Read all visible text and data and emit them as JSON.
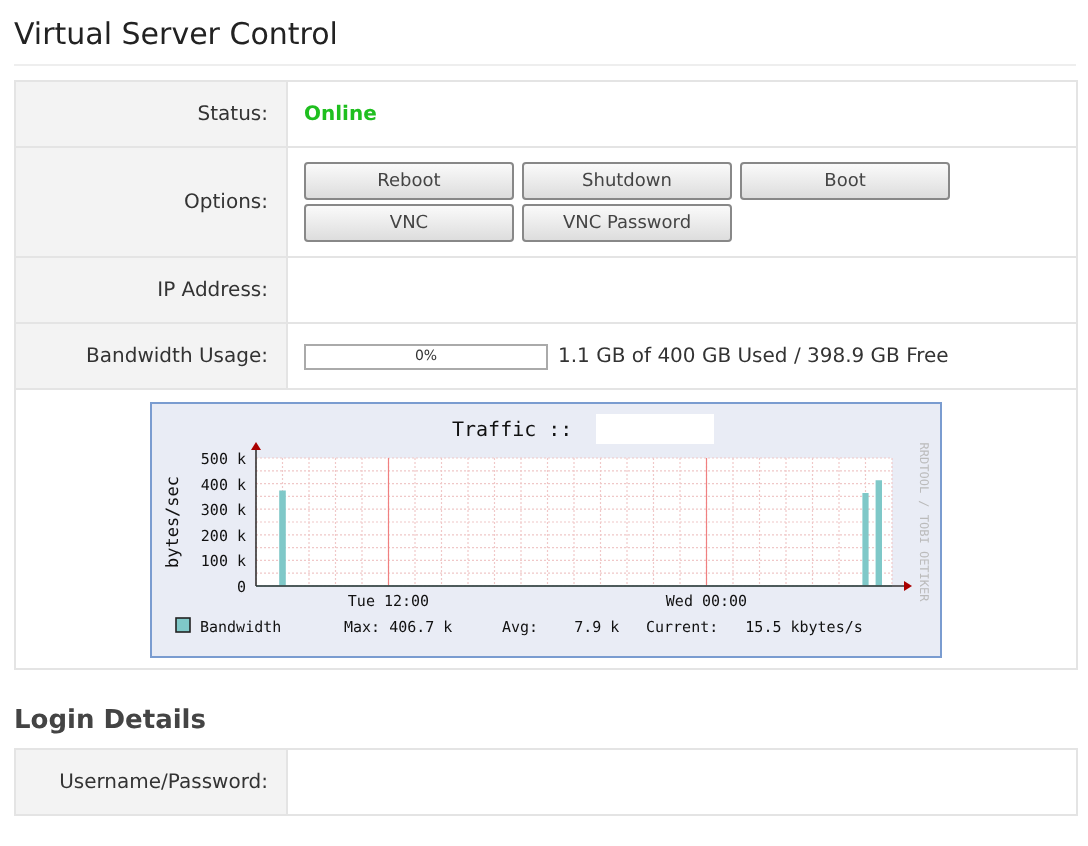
{
  "title": "Virtual Server Control",
  "details": [
    {
      "kind": "status",
      "label": "Status:",
      "value": "Online"
    },
    {
      "kind": "buttons",
      "label": "Options:",
      "buttons": [
        "Reboot",
        "Shutdown",
        "Boot",
        "VNC",
        "VNC Password"
      ]
    },
    {
      "kind": "empty",
      "label": "IP Address:"
    },
    {
      "kind": "usage",
      "label": "Bandwidth Usage:",
      "level": 0,
      "percent": "0%",
      "summary": "1.1 GB of 400 GB Used / 398.9 GB Free"
    }
  ],
  "graph": {
    "credit": "RRDTOOL / TOBI OETIKER",
    "legend": {
      "max": "Max: 406.7 k",
      "avg": "Avg:    7.9 k",
      "current": "Current:   15.5 kbytes/s"
    },
    "chart_data": {
      "type": "area",
      "title": "Traffic ::",
      "ylabel": "bytes/sec",
      "categories": [
        null,
        null,
        null,
        null,
        null,
        null,
        null,
        null,
        null,
        null,
        "Tue 12:00",
        null,
        null,
        null,
        null,
        null,
        null,
        null,
        null,
        null,
        null,
        null,
        null,
        null,
        null,
        null,
        null,
        null,
        null,
        null,
        null,
        null,
        null,
        null,
        "Wed 00:00",
        null,
        null,
        null,
        null,
        null,
        null,
        null,
        null,
        null,
        null,
        null,
        null,
        null,
        null
      ],
      "series": [
        {
          "name": "Bandwidth",
          "color": "#7fc8c8",
          "values": [
            0,
            0,
            370000,
            0,
            0,
            0,
            0,
            0,
            0,
            0,
            0,
            0,
            0,
            0,
            0,
            0,
            0,
            0,
            0,
            0,
            0,
            0,
            0,
            0,
            0,
            0,
            0,
            0,
            0,
            0,
            0,
            0,
            0,
            0,
            0,
            0,
            0,
            0,
            0,
            0,
            0,
            0,
            0,
            0,
            0,
            0,
            360000,
            410000,
            0
          ]
        }
      ],
      "ylim": [
        0,
        500000
      ],
      "grid": true,
      "yticks": [
        {
          "value": 0,
          "label": "0"
        },
        {
          "value": 100000,
          "label": "100 k"
        },
        {
          "value": 200000,
          "label": "200 k"
        },
        {
          "value": 300000,
          "label": "300 k"
        },
        {
          "value": 400000,
          "label": "400 k"
        },
        {
          "value": 500000,
          "label": "500 k"
        }
      ]
    }
  },
  "login": {
    "title": "Login Details",
    "rows": [
      {
        "label": "Username/Password:"
      }
    ]
  }
}
